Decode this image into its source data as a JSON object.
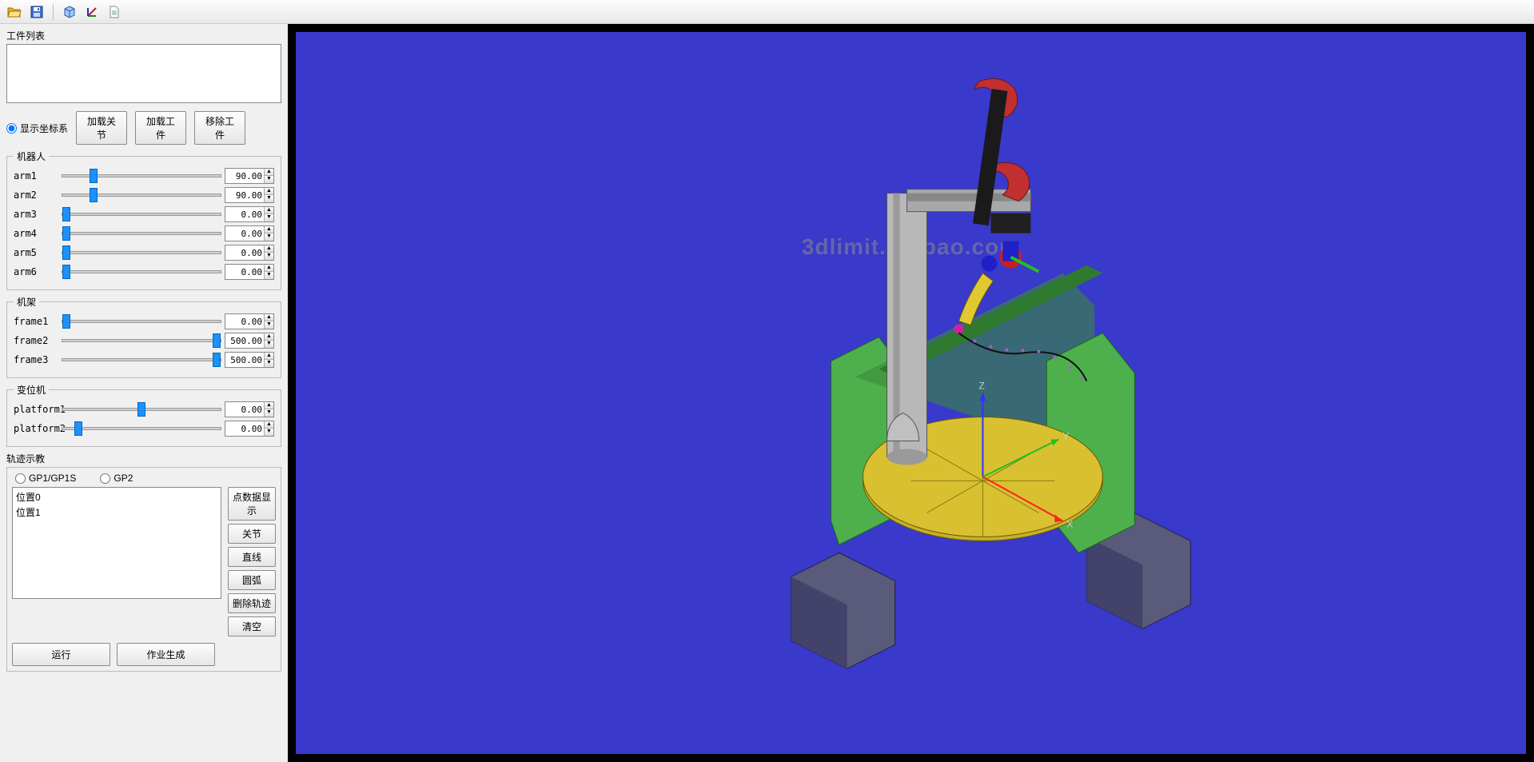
{
  "toolbar": {
    "open_icon": "open-folder",
    "save_icon": "save-disk",
    "view_icon": "3d-cube",
    "axis_icon": "axis-tool",
    "doc_icon": "document"
  },
  "workpiece": {
    "list_label": "工件列表",
    "show_coord_label": "显示坐标系",
    "load_joint_btn": "加载关节",
    "load_work_btn": "加载工件",
    "remove_work_btn": "移除工件"
  },
  "robot": {
    "legend": "机器人",
    "arms": [
      {
        "label": "arm1",
        "value": "90.00",
        "pos": 18
      },
      {
        "label": "arm2",
        "value": "90.00",
        "pos": 18
      },
      {
        "label": "arm3",
        "value": "0.00",
        "pos": 0
      },
      {
        "label": "arm4",
        "value": "0.00",
        "pos": 0
      },
      {
        "label": "arm5",
        "value": "0.00",
        "pos": 0
      },
      {
        "label": "arm6",
        "value": "0.00",
        "pos": 0
      }
    ]
  },
  "frame": {
    "legend": "机架",
    "items": [
      {
        "label": "frame1",
        "value": "0.00",
        "pos": 0
      },
      {
        "label": "frame2",
        "value": "500.00",
        "pos": 100
      },
      {
        "label": "frame3",
        "value": "500.00",
        "pos": 100
      }
    ]
  },
  "platform": {
    "legend": "变位机",
    "items": [
      {
        "label": "platform1",
        "value": "0.00",
        "pos": 50
      },
      {
        "label": "platform2",
        "value": "0.00",
        "pos": 8
      }
    ]
  },
  "teach": {
    "label": "轨迹示教",
    "gp1_label": "GP1/GP1S",
    "gp2_label": "GP2",
    "positions": [
      "位置0",
      "位置1"
    ],
    "show_points_btn": "点数据显示",
    "joint_btn": "关节",
    "line_btn": "直线",
    "arc_btn": "圆弧",
    "delete_btn": "删除轨迹",
    "clear_btn": "清空",
    "run_btn": "运行",
    "generate_btn": "作业生成"
  },
  "viewport": {
    "watermark": "3dlimit.taobao.com",
    "axis_z": "Z",
    "axis_y": "Y",
    "axis_x": "X"
  }
}
